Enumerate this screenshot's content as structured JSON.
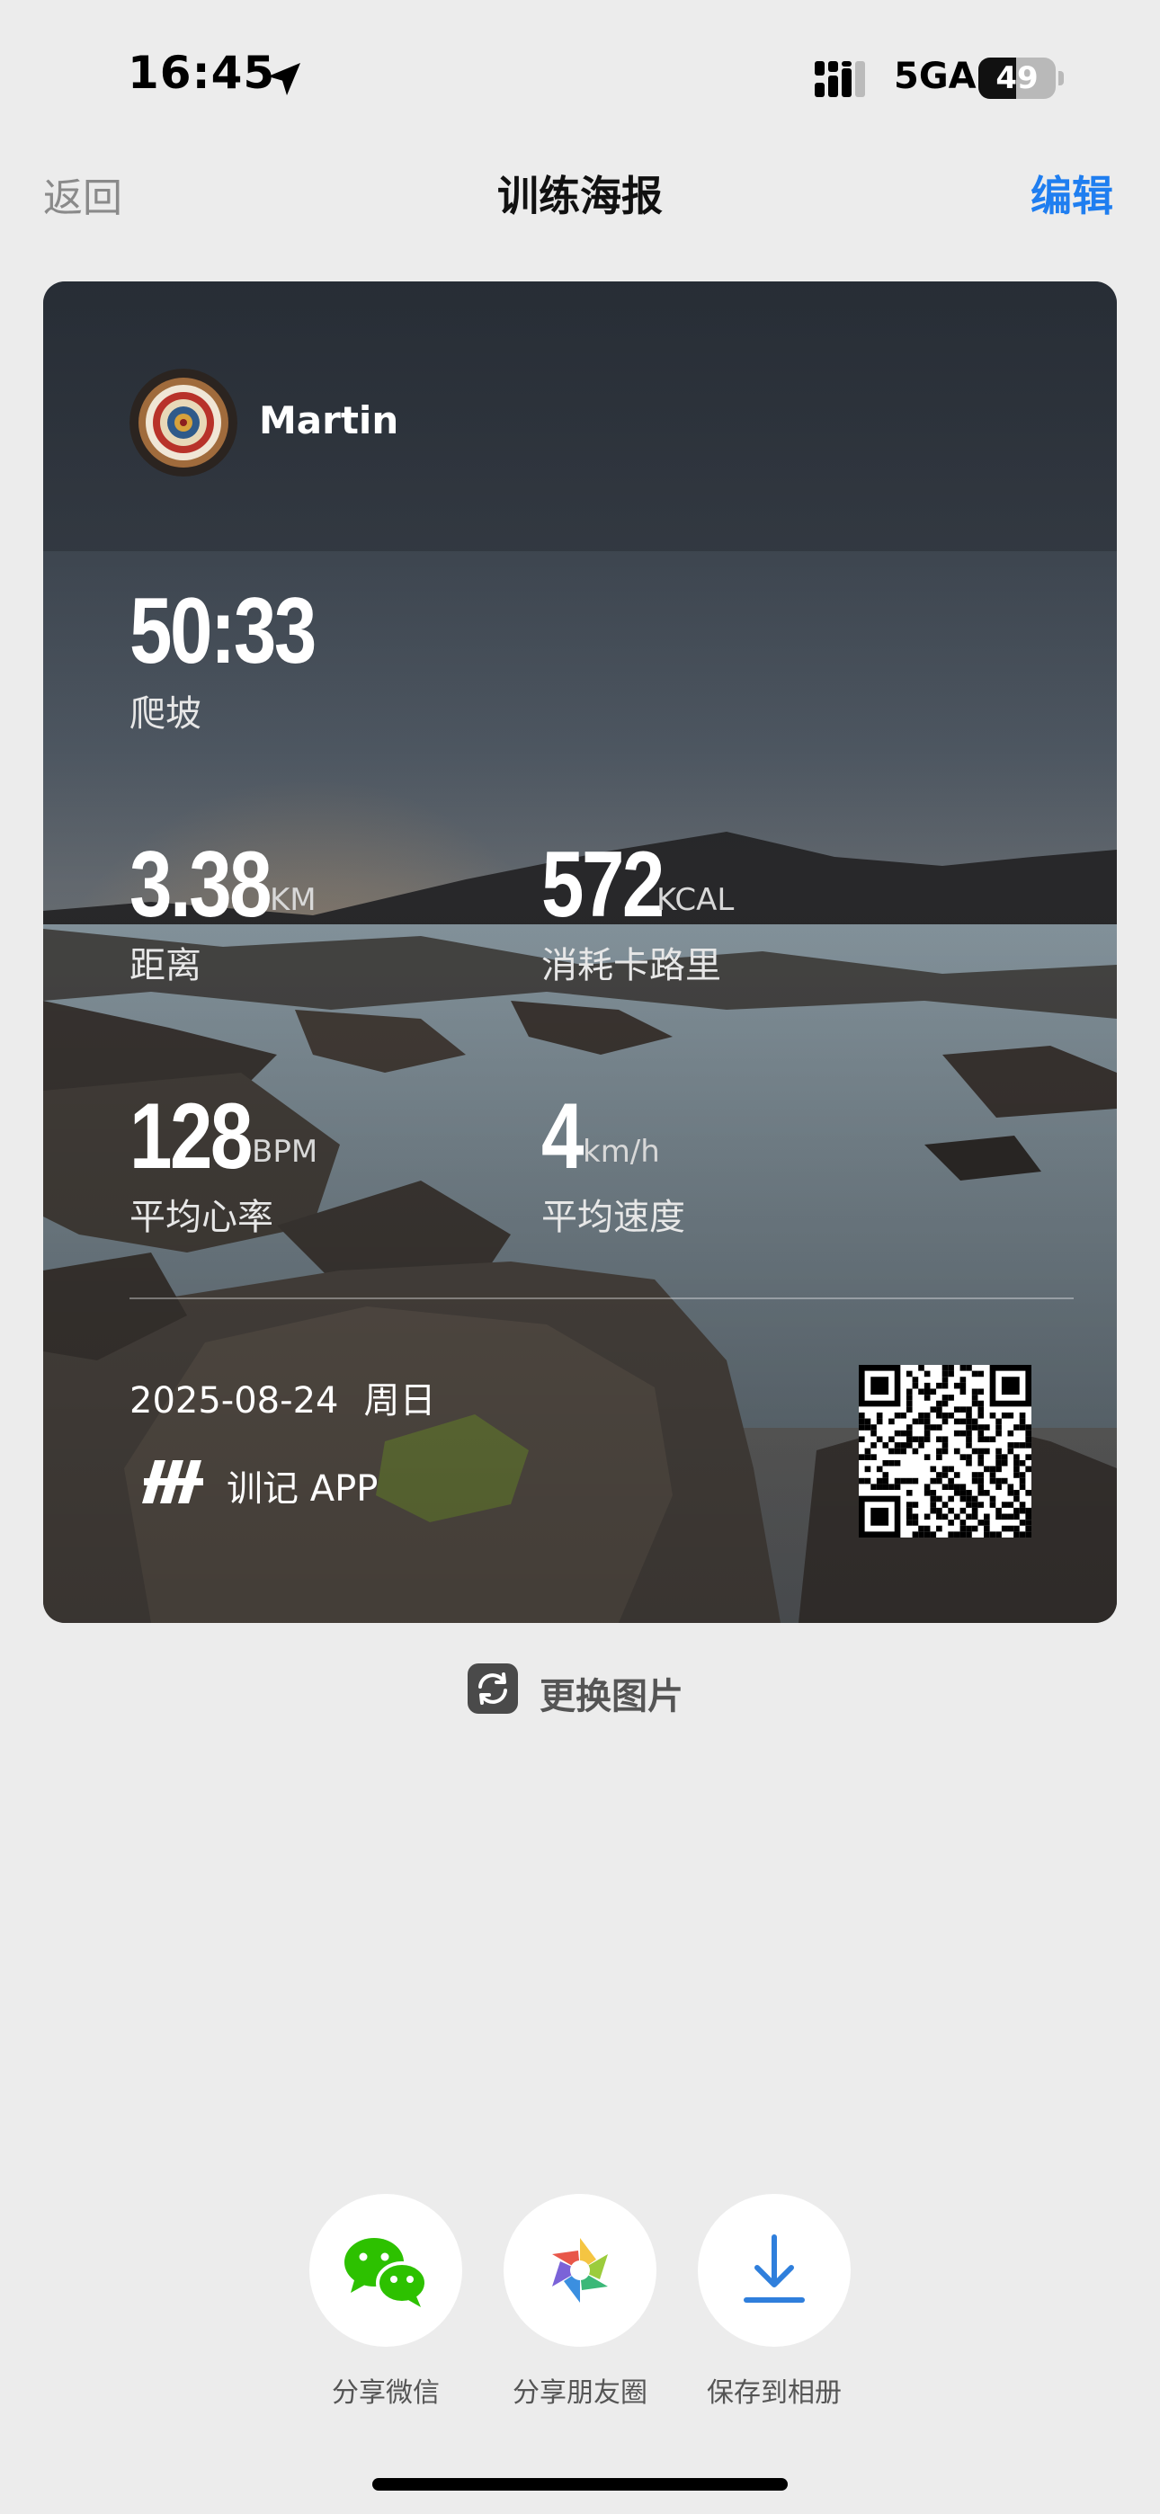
{
  "status_bar": {
    "time": "16:45",
    "network": "5GA",
    "battery": "49",
    "battery_level": 0.49
  },
  "nav": {
    "back": "返回",
    "title": "训练海报",
    "edit": "编辑"
  },
  "poster": {
    "user_name": "Martin",
    "duration": {
      "value": "50:33",
      "label": "爬坡"
    },
    "distance": {
      "value": "3.38",
      "unit": "KM",
      "label": "距离"
    },
    "calories": {
      "value": "572",
      "unit": "KCAL",
      "label": "消耗卡路里"
    },
    "heart_rate": {
      "value": "128",
      "unit": "BPM",
      "label": "平均心率"
    },
    "speed": {
      "value": "4",
      "unit": "km/h",
      "label": "平均速度"
    },
    "date": "2025-08-24",
    "weekday": "周日",
    "brand": "训记 APP"
  },
  "change_photo": {
    "label": "更换图片",
    "icon": "swap-image-icon"
  },
  "actions": [
    {
      "label": "分享微信",
      "icon": "wechat-icon",
      "color": "#2dc100"
    },
    {
      "label": "分享朋友圈",
      "icon": "moments-icon"
    },
    {
      "label": "保存到相册",
      "icon": "download-icon",
      "color": "#2f7fdc"
    }
  ],
  "colors": {
    "accent": "#1f7ef0",
    "background": "#ececec"
  }
}
